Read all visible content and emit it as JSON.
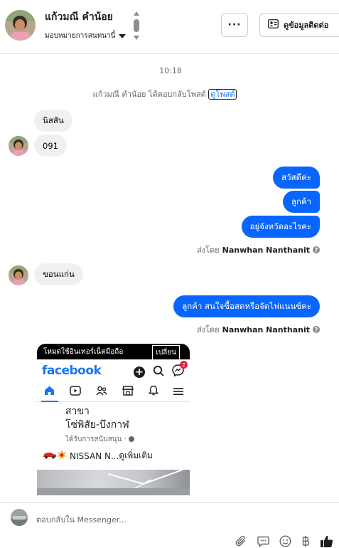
{
  "header": {
    "contact_name": "แก้วมณี คำน้อย",
    "assignment": "มอบหมายการสนทนานี้",
    "more_label": "···",
    "view_contact_label": "ดูข้อมูลติดต่อ"
  },
  "thread": {
    "timestamp": "10:18",
    "system_message": "แก้วมณี คำน้อย ได้ตอบกลับโพสต์",
    "system_link": "ดูโพสต์",
    "incoming_1": [
      "นิสสัน",
      "091"
    ],
    "outgoing_1": [
      "สวัสดีค่ะ",
      "ลูกค้า",
      "อยู่จังหวัดอะไรคะ"
    ],
    "sent_by_prefix": "ส่งโดย",
    "sender_name": "Nanwhan Nanthanit",
    "incoming_2": "ขอนแก่น",
    "outgoing_2": "ลูกค้า สนใจซื้อสดหรือจัดไฟแนนซ์คะ"
  },
  "attachment": {
    "banner_text": "โหมดใช้อินเทอร์เน็ตมือถือ",
    "banner_button": "เปลี่ยน",
    "app_logo": "facebook",
    "notification_count": "2",
    "post_title_line1": "สาขา",
    "post_title_line2": "โซ่พิสัย-บึงกาฬ",
    "post_sponsored": "ได้รับการสนับสนุน · ",
    "post_line_text": "NISSAN N...",
    "post_more": " ดูเพิ่มเติม"
  },
  "composer": {
    "placeholder": "ตอบกลับใน Messenger..."
  },
  "colors": {
    "outgoing_bubble": "#0866ff",
    "incoming_bubble": "#f0f0f0",
    "facebook_blue": "#1877f2",
    "like_icon": "#1c1e21"
  }
}
